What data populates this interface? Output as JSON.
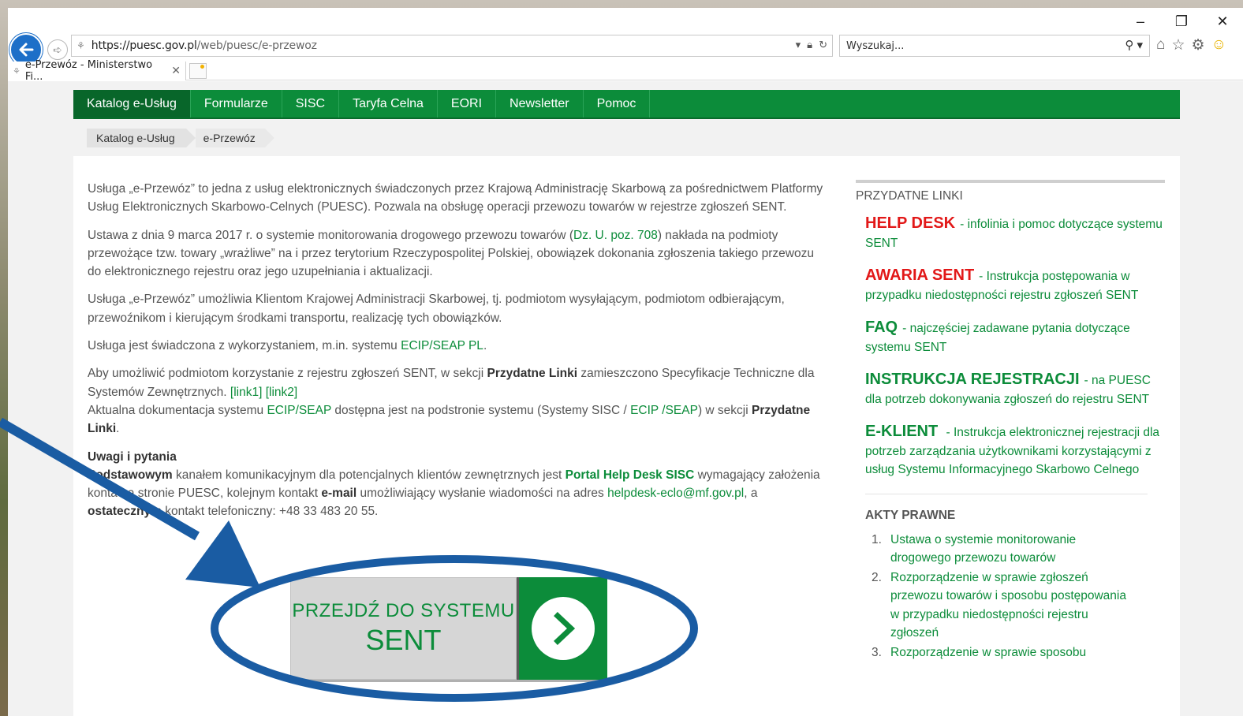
{
  "browser": {
    "address_url_host": "https://puesc.gov.pl",
    "address_url_path": "/web/puesc/e-przewoz",
    "search_placeholder": "Wyszukaj...",
    "tab_title": "e-Przewóz - Ministerstwo Fi...",
    "window_controls": [
      "–",
      "❐",
      "✕"
    ]
  },
  "menu": {
    "items": [
      "Katalog e-Usług",
      "Formularze",
      "SISC",
      "Taryfa Celna",
      "EORI",
      "Newsletter",
      "Pomoc"
    ]
  },
  "breadcrumb": [
    "Katalog e-Usług",
    "e-Przewóz"
  ],
  "main": {
    "p1": "Usługa „e-Przewóz” to jedna z usług elektronicznych świadczonych przez Krajową Administrację Skarbową za pośrednictwem Platformy Usług Elektronicznych Skarbowo-Celnych (PUESC). Pozwala na obsługę operacji przewozu towarów w rejestrze zgłoszeń SENT.",
    "p2_a": "Ustawa z dnia 9 marca 2017 r. o systemie monitorowania drogowego przewozu towarów (",
    "p2_link": "Dz. U. poz. 708",
    "p2_b": ") nakłada na podmioty przewożące tzw. towary „wrażliwe” na i przez terytorium Rzeczypospolitej Polskiej, obowiązek dokonania zgłoszenia takiego przewozu do elektronicznego rejestru oraz jego uzupełniania i aktualizacji.",
    "p3": "Usługa „e-Przewóz” umożliwia Klientom Krajowej Administracji Skarbowej, tj. podmiotom wysyłającym, podmiotom odbierającym, przewoźnikom i kierującym środkami transportu, realizację tych obowiązków.",
    "p4_a": "Usługa jest świadczona z wykorzystaniem, m.in. systemu ",
    "p4_link": "ECIP/SEAP PL",
    "p4_b": ".",
    "p5_a": "Aby umożliwić podmiotom korzystanie z rejestru zgłoszeń SENT, w sekcji ",
    "p5_bold": "Przydatne Linki",
    "p5_b": " zamieszczono Specyfikacje Techniczne dla Systemów Zewnętrznych. ",
    "p5_link1": "[link1]",
    "p5_link2": "[link2]",
    "p6_a": "Aktualna dokumentacja systemu ",
    "p6_link1": "ECIP/SEAP",
    "p6_b": "  dostępna jest na podstronie systemu (Systemy SISC / ",
    "p6_link2": "ECIP /SEAP",
    "p6_c": ") w sekcji ",
    "p6_bold": "Przydatne Linki",
    "p6_d": ".",
    "uwagi_heading": "Uwagi i pytania",
    "p7_bold1": "Podstawowym",
    "p7_a": " kanałem komunikacyjnym dla potencjalnych klientów zewnętrznych jest ",
    "p7_link_bold": "Portal Help Desk SISC",
    "p7_b": " wymagający założenia konta na stronie PUESC, kolejnym kontakt ",
    "p7_bold2": "e-mail",
    "p7_c": " umożliwiający wysłanie wiadomości na adres ",
    "p7_email": "helpdesk-eclo@mf.gov.pl",
    "p7_d": ", a ",
    "p7_bold3": "ostatecznym",
    "p7_e": " kontakt telefoniczny: +48 33 483 20 55."
  },
  "sidebar": {
    "heading": "PRZYDATNE LINKI",
    "links": [
      {
        "keyword": "HELP DESK",
        "text": "- infolinia i pomoc dotyczące systemu SENT",
        "color": "#e21818"
      },
      {
        "keyword": "AWARIA SENT",
        "text": "- Instrukcja postępowania w przypadku niedostępności rejestru zgłoszeń SENT",
        "color": "#e21818"
      },
      {
        "keyword": "FAQ",
        "text": "- najczęściej zadawane pytania dotyczące systemu SENT",
        "color": "#0c8c3a"
      },
      {
        "keyword": "INSTRUKCJA REJESTRACJI",
        "text": "- na PUESC dla potrzeb dokonywania zgłoszeń do rejestru SENT",
        "color": "#0c8c3a"
      },
      {
        "keyword": "E-KLIENT",
        "text": " - Instrukcja elektronicznej rejestracji dla potrzeb zarządzania użytkownikami korzystającymi z usług Systemu Informacyjnego Skarbowo Celnego",
        "color": "#0c8c3a"
      }
    ],
    "acts_heading": "AKTY PRAWNE",
    "acts": [
      {
        "num": "1.",
        "text": "Ustawa o systemie monitorowanie drogowego przewozu towarów"
      },
      {
        "num": "2.",
        "text": "Rozporządzenie w sprawie zgłoszeń przewozu towarów i sposobu postępowania w przypadku niedostępności rejestru zgłoszeń"
      },
      {
        "num": "3.",
        "text": "Rozporządzenie w sprawie sposobu"
      }
    ]
  },
  "cta": {
    "line1": "PRZEJDŹ DO SYSTEMU",
    "line2": "SENT"
  },
  "colors": {
    "brand_green": "#0c8c3a",
    "alert_red": "#e21818",
    "annotation_blue": "#1a5ca3"
  }
}
